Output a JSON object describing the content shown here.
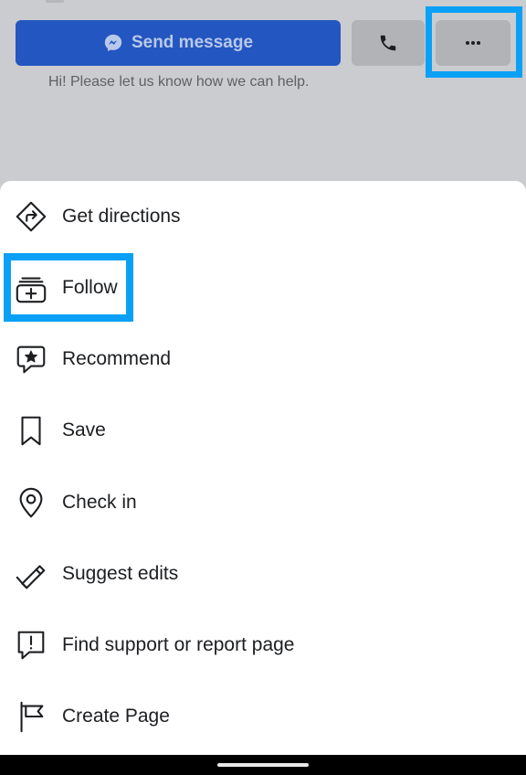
{
  "header": {
    "send_message_label": "Send message",
    "greeting": "Hi! Please let us know how we can help."
  },
  "menu": {
    "items": [
      {
        "label": "Get directions",
        "icon": "directions-icon"
      },
      {
        "label": "Follow",
        "icon": "follow-icon"
      },
      {
        "label": "Recommend",
        "icon": "recommend-icon"
      },
      {
        "label": "Save",
        "icon": "bookmark-icon"
      },
      {
        "label": "Check in",
        "icon": "location-pin-icon"
      },
      {
        "label": "Suggest edits",
        "icon": "pencil-icon"
      },
      {
        "label": "Find support or report page",
        "icon": "report-icon"
      },
      {
        "label": "Create Page",
        "icon": "flag-icon"
      }
    ]
  },
  "colors": {
    "primary_blue": "#2356c0",
    "highlight": "#0aa0f5",
    "text": "#1c1e21"
  }
}
